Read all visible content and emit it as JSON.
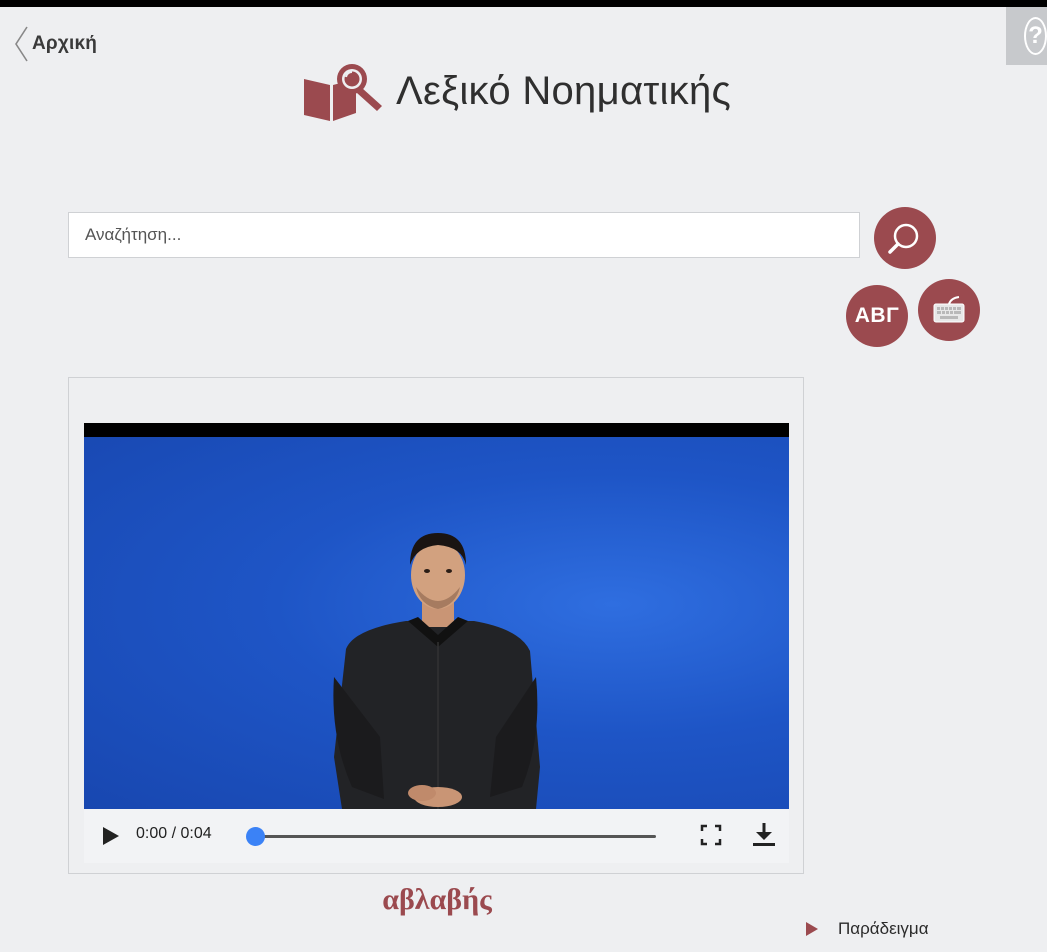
{
  "nav": {
    "back_label": "Αρχική",
    "help_label": "?"
  },
  "header": {
    "title": "Λεξικό Νοηματικής"
  },
  "search": {
    "placeholder": "Αναζήτηση...",
    "value": ""
  },
  "buttons": {
    "alphabet_label": "ΑΒΓ"
  },
  "video": {
    "time_display": "0:00 / 0:04",
    "progress": 0.0
  },
  "word": {
    "text": "αβλαβής"
  },
  "links": {
    "example_label": "Παράδειγμα"
  },
  "colors": {
    "accent": "#9b4a4f",
    "background": "#eeeff1",
    "video_bg": "#1e55c6",
    "progress": "#3b82f6"
  },
  "icons": [
    "back-chevron-icon",
    "help-icon",
    "book-search-logo-icon",
    "search-icon",
    "keyboard-icon",
    "play-icon",
    "fullscreen-icon",
    "download-icon",
    "triangle-right-icon"
  ]
}
